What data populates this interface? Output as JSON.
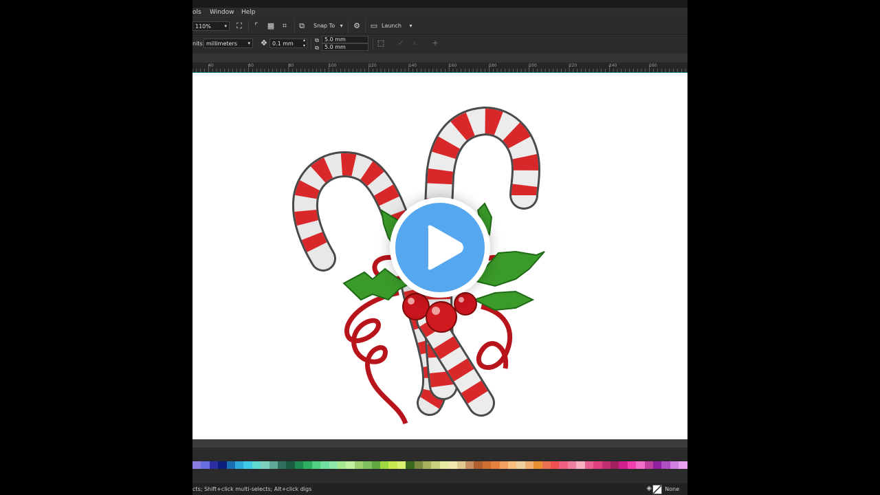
{
  "menu": {
    "tools_fragment": "ols",
    "window": "Window",
    "help": "Help"
  },
  "toolbar1": {
    "zoom_value": "110%",
    "snap_label": "Snap To",
    "launch_label": "Launch"
  },
  "toolbar2": {
    "units_label": "nits:",
    "units_value": "millimeters",
    "nudge_value": "0.1 mm",
    "dup_x": "5.0 mm",
    "dup_y": "5.0 mm"
  },
  "ruler": {
    "ticks": [
      "40",
      "60",
      "80",
      "100",
      "120",
      "140",
      "160",
      "180",
      "200",
      "220",
      "240",
      "260"
    ]
  },
  "status": {
    "hint": "cts; Shift+click multi-selects; Alt+click digs",
    "fill_label": "None"
  },
  "palette": [
    "#8a7fe0",
    "#6a6fe0",
    "#2b2fa0",
    "#0a1f7a",
    "#1a6fb0",
    "#2ea8d8",
    "#40c8e8",
    "#5fd8d0",
    "#7fcfc0",
    "#5fa898",
    "#2f7060",
    "#1a5a40",
    "#1f8a50",
    "#2fb060",
    "#4fd080",
    "#6fe0a0",
    "#8fe8a8",
    "#a8e890",
    "#c0f0a0",
    "#9fd070",
    "#80c060",
    "#60a840",
    "#a0d840",
    "#c8e850",
    "#d8f070",
    "#3a6a20",
    "#7a8a40",
    "#a8b060",
    "#c8d080",
    "#e8e8a0",
    "#f0e8b0",
    "#e0c890",
    "#c89060",
    "#b06030",
    "#d07030",
    "#e88040",
    "#f0a060",
    "#f8c080",
    "#f0d0a0",
    "#f0b070",
    "#e89030",
    "#e87050",
    "#f05050",
    "#f06080",
    "#f080a0",
    "#f8b0c0",
    "#e86090",
    "#e04080",
    "#c03070",
    "#a02060",
    "#d02090",
    "#f040b0",
    "#f070c8",
    "#c040a0",
    "#9020a0",
    "#b050c0",
    "#d080e0",
    "#e8a0f0"
  ],
  "overlay": {
    "icon": "play-icon"
  }
}
